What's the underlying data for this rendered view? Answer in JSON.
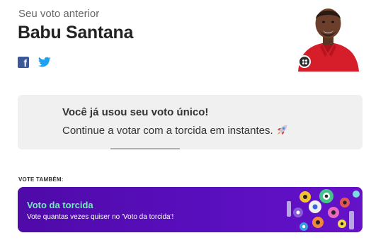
{
  "previous_vote": {
    "label": "Seu voto anterior",
    "candidate_name": "Babu Santana",
    "share": {
      "facebook_icon": "facebook-icon",
      "twitter_icon": "twitter-icon"
    },
    "photo": {
      "subject": "candidate-photo",
      "menu_icon": "grid-dots-icon"
    }
  },
  "notice": {
    "title": "Você já usou seu voto único!",
    "text": "Continue a votar com a torcida em instantes.",
    "icon": "rocket-icon"
  },
  "vote_also": {
    "label": "VOTE TAMBÉM:",
    "banner": {
      "title": "Voto da torcida",
      "subtitle": "Vote quantas vezes quiser no 'Voto da torcida'!",
      "art_icon": "eye-characters-illustration"
    }
  },
  "colors": {
    "banner_bg": "#5a0fc0",
    "banner_title": "#6ef0b5",
    "facebook": "#3b5998",
    "twitter": "#1da1f2",
    "notice_bg": "#f0f0f0"
  }
}
